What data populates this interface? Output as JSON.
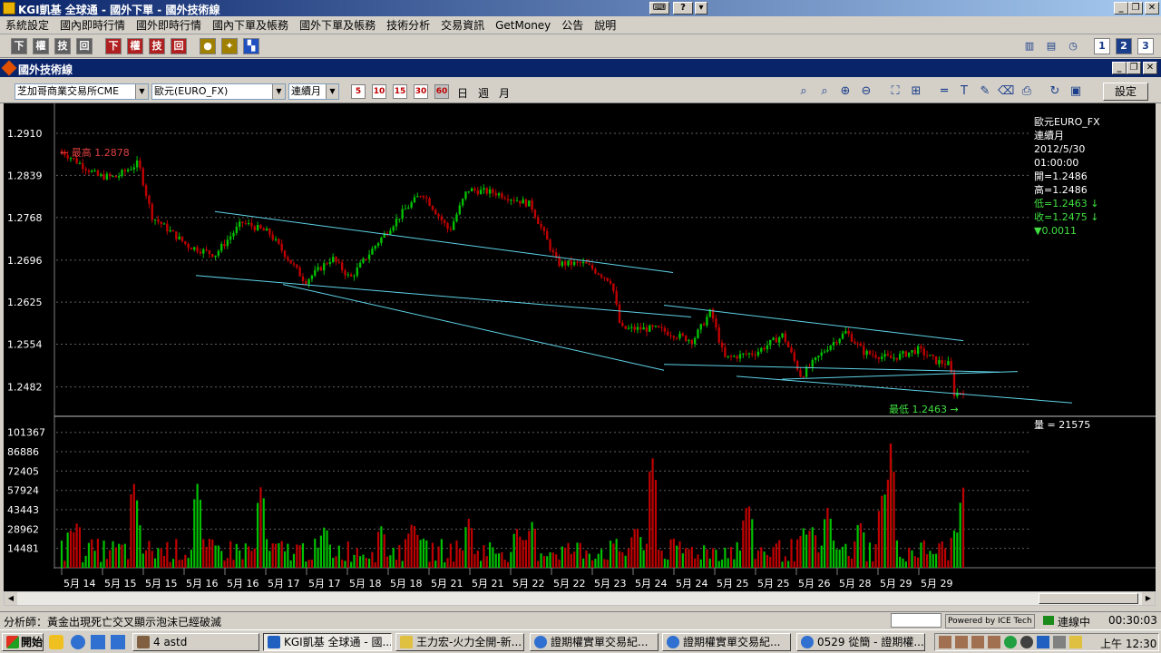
{
  "window": {
    "title": "KGI凱基 全球通 - 國外下單 - 國外技術線"
  },
  "menu": [
    "系統設定",
    "國內即時行情",
    "國外即時行情",
    "國內下單及帳務",
    "國外下單及帳務",
    "技術分析",
    "交易資訊",
    "GetMoney",
    "公告",
    "說明"
  ],
  "toolbar1": {
    "red_group": [
      "下",
      "權",
      "技",
      "回"
    ],
    "gray_group": [
      "下",
      "權",
      "技",
      "回"
    ]
  },
  "subwindow": {
    "title": "國外技術線"
  },
  "controls": {
    "exchange": "芝加哥商業交易所CME",
    "contract": "歐元(EURO_FX)",
    "period_type": "連續月",
    "periods": [
      "5",
      "10",
      "15",
      "30",
      "60"
    ],
    "period_text": [
      "日",
      "週",
      "月"
    ],
    "settings_label": "設定"
  },
  "chart_data": [
    {
      "type": "candlestick",
      "title": "歐元EURO_FX",
      "y_ticks": [
        "1.2910",
        "1.2839",
        "1.2768",
        "1.2696",
        "1.2625",
        "1.2554",
        "1.2482"
      ],
      "ylim": [
        1.244,
        1.293
      ],
      "x_labels": [
        "5月 14",
        "5月 15",
        "5月 15",
        "5月 16",
        "5月 16",
        "5月 17",
        "5月 17",
        "5月 18",
        "5月 18",
        "5月 21",
        "5月 21",
        "5月 22",
        "5月 22",
        "5月 23",
        "5月 24",
        "5月 24",
        "5月 25",
        "5月 25",
        "5月 26",
        "5月 28",
        "5月 29",
        "5月 29"
      ],
      "high_label": "← 最高 1.2878",
      "low_label": "最低 1.2463 →",
      "path": [
        [
          0,
          1.288
        ],
        [
          0.04,
          1.2838
        ],
        [
          0.06,
          1.2836
        ],
        [
          0.085,
          1.286
        ],
        [
          0.1,
          1.277
        ],
        [
          0.14,
          1.272
        ],
        [
          0.17,
          1.2705
        ],
        [
          0.2,
          1.276
        ],
        [
          0.23,
          1.2742
        ],
        [
          0.27,
          1.266
        ],
        [
          0.3,
          1.27
        ],
        [
          0.32,
          1.2665
        ],
        [
          0.35,
          1.2725
        ],
        [
          0.38,
          1.278
        ],
        [
          0.4,
          1.281
        ],
        [
          0.43,
          1.2745
        ],
        [
          0.45,
          1.2815
        ],
        [
          0.48,
          1.281
        ],
        [
          0.52,
          1.279
        ],
        [
          0.55,
          1.269
        ],
        [
          0.58,
          1.269
        ],
        [
          0.61,
          1.266
        ],
        [
          0.62,
          1.258
        ],
        [
          0.66,
          1.258
        ],
        [
          0.7,
          1.256
        ],
        [
          0.72,
          1.261
        ],
        [
          0.735,
          1.253
        ],
        [
          0.77,
          1.254
        ],
        [
          0.8,
          1.257
        ],
        [
          0.82,
          1.25
        ],
        [
          0.85,
          1.255
        ],
        [
          0.87,
          1.2575
        ],
        [
          0.89,
          1.254
        ],
        [
          0.92,
          1.253
        ],
        [
          0.95,
          1.2545
        ],
        [
          0.97,
          1.2525
        ],
        [
          0.985,
          1.252
        ],
        [
          0.99,
          1.247
        ],
        [
          1,
          1.2475
        ]
      ],
      "info_panel": {
        "name": "歐元EURO_FX",
        "period": "連續月",
        "date": "2012/5/30",
        "time": "01:00:00",
        "open": "開=1.2486",
        "high": "高=1.2486",
        "low": "低=1.2463 ↓",
        "close": "收=1.2475 ↓",
        "change": "▼0.0011"
      },
      "colors": {
        "up": "#00c000",
        "down": "#c00000",
        "trend": "#5fd3e8",
        "grid": "#606060"
      }
    },
    {
      "type": "bar",
      "title": "量",
      "volume_label": "量 = 21575",
      "y_ticks": [
        "101367",
        "86886",
        "72405",
        "57924",
        "43443",
        "28962",
        "14481"
      ],
      "ylim": [
        0,
        110000
      ],
      "peaks": [
        [
          0.01,
          30000
        ],
        [
          0.02,
          35000
        ],
        [
          0.09,
          65000
        ],
        [
          0.095,
          38000
        ],
        [
          0.17,
          63000
        ],
        [
          0.25,
          62000
        ],
        [
          0.33,
          32000
        ],
        [
          0.4,
          32000
        ],
        [
          0.44,
          35000
        ],
        [
          0.51,
          37000
        ],
        [
          0.57,
          30000
        ],
        [
          0.59,
          35000
        ],
        [
          0.72,
          32000
        ],
        [
          0.74,
          85000
        ],
        [
          0.86,
          50000
        ],
        [
          0.93,
          30000
        ],
        [
          0.94,
          32000
        ],
        [
          0.96,
          45000
        ],
        [
          1.0,
          36000
        ],
        [
          1.03,
          60000
        ],
        [
          1.04,
          85000
        ],
        [
          1.12,
          30000
        ],
        [
          1.13,
          60000
        ]
      ],
      "red_peak": "93000"
    }
  ],
  "status": {
    "analyst_text": "分析師：黃金出現死亡交叉顯示泡沫已經破滅",
    "powered": "Powered by ICE Tech",
    "connection": "連線中",
    "timer": "00:30:03"
  },
  "taskbar": {
    "start": "開始",
    "tasks": [
      "4 astd",
      "KGI凱基 全球通 - 國...",
      "王力宏-火力全開-新...",
      "證期權實單交易紀...",
      "證期權實單交易紀...",
      "0529 從簡 - 證期權..."
    ],
    "clock": "上午 12:30"
  }
}
